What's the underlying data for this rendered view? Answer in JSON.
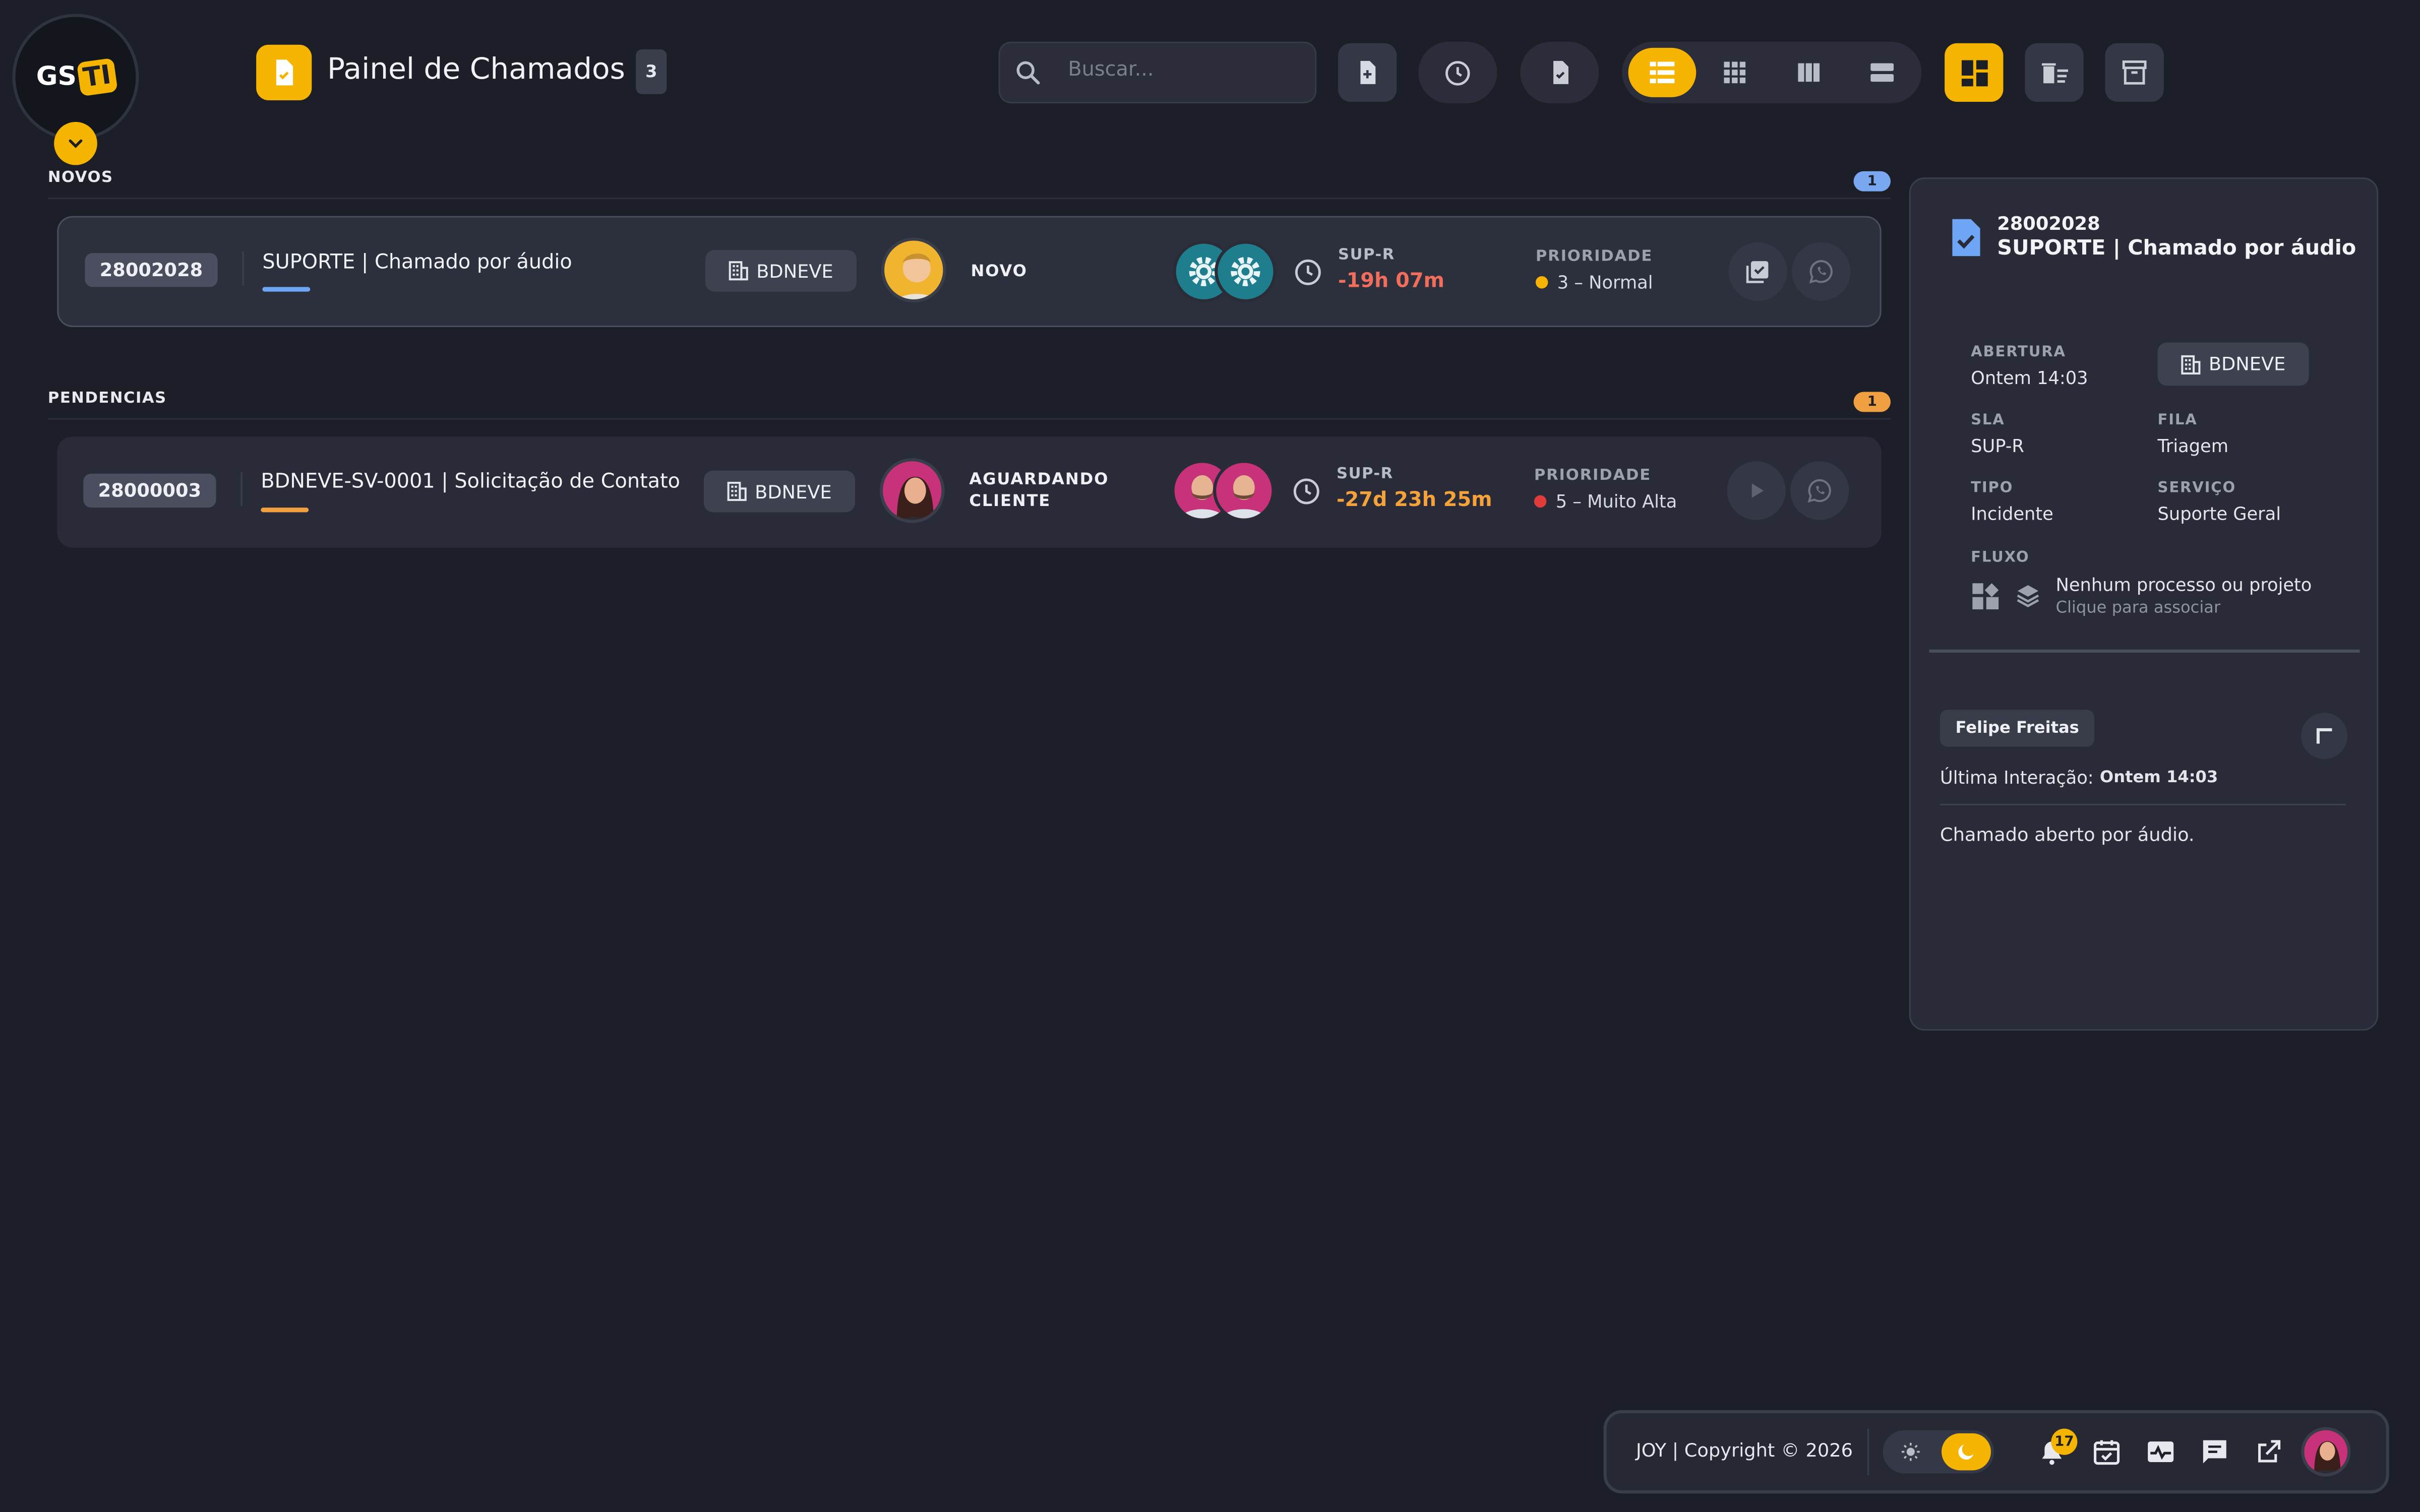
{
  "logo": {
    "text_gs": "GS",
    "text_ti": "TI"
  },
  "header": {
    "title": "Painel de Chamados",
    "count": "3"
  },
  "search": {
    "placeholder": "Buscar..."
  },
  "sections": [
    {
      "label": "NOVOS",
      "count": "1",
      "color": "#7aa8f0"
    },
    {
      "label": "PENDENCIAS",
      "count": "1",
      "color": "#f0a040"
    }
  ],
  "tickets": [
    {
      "id": "28002028",
      "title": "SUPORTE | Chamado por áudio",
      "client": "BDNEVE",
      "status": "NOVO",
      "sla_label": "SUP-R",
      "sla_value": "-19h 07m",
      "sla_color": "#f26d5c",
      "priority_label": "PRIORIDADE",
      "priority": "3 – Normal",
      "priority_color": "#f5b400",
      "underline_color": "#6ea6f5"
    },
    {
      "id": "28000003",
      "title": "BDNEVE-SV-0001 | Solicitação de Contato",
      "client": "BDNEVE",
      "status_line1": "AGUARDANDO",
      "status_line2": "CLIENTE",
      "sla_label": "SUP-R",
      "sla_value": "-27d 23h 25m",
      "sla_color": "#f5a23b",
      "priority_label": "PRIORIDADE",
      "priority": "5 – Muito Alta",
      "priority_color": "#e23b3b",
      "underline_color": "#f0a040"
    }
  ],
  "panel": {
    "id": "28002028",
    "title": "SUPORTE | Chamado por áudio",
    "abertura_label": "ABERTURA",
    "abertura": "Ontem 14:03",
    "client": "BDNEVE",
    "sla_label": "SLA",
    "sla": "SUP-R",
    "fila_label": "FILA",
    "fila": "Triagem",
    "tipo_label": "TIPO",
    "tipo": "Incidente",
    "servico_label": "SERVIÇO",
    "servico": "Suporte Geral",
    "fluxo_label": "FLUXO",
    "fluxo_main": "Nenhum processo ou projeto",
    "fluxo_sub": "Clique para associar",
    "author": "Felipe Freitas",
    "last_label": "Última Interação:",
    "last_value": "Ontem 14:03",
    "message": "Chamado aberto por áudio."
  },
  "footer": {
    "copyright": "JOY | Copyright",
    "year": "2026",
    "notifications": "17"
  },
  "colors": {
    "accent": "#f5b400",
    "background": "#1d1f28",
    "card": "#292c38"
  },
  "icons": [
    "search-icon",
    "new-ticket-icon",
    "clock-icon",
    "approved-doc-icon",
    "list-view-icon",
    "grid-view-icon",
    "columns-view-icon",
    "rows-view-icon",
    "dashboard-icon",
    "delete-filter-icon",
    "archive-icon",
    "building-icon",
    "whatsapp-icon",
    "check-list-icon",
    "play-icon",
    "gear-icon",
    "sun-icon",
    "moon-icon",
    "bell-icon",
    "calendar-icon",
    "activity-icon",
    "chat-icon",
    "external-link-icon"
  ]
}
